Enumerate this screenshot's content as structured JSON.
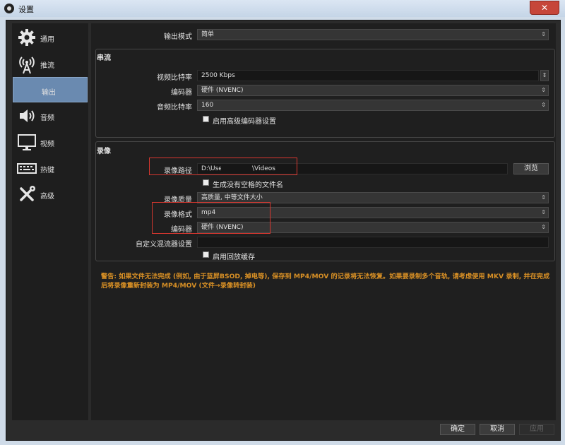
{
  "window": {
    "title": "设置",
    "close": "✕"
  },
  "sidebar": {
    "items": [
      {
        "label": "通用",
        "icon": "gear-icon"
      },
      {
        "label": "推流",
        "icon": "antenna-icon"
      },
      {
        "label": "输出",
        "icon": "output-icon",
        "active": true
      },
      {
        "label": "音频",
        "icon": "speaker-icon"
      },
      {
        "label": "视频",
        "icon": "monitor-icon"
      },
      {
        "label": "热键",
        "icon": "keyboard-icon"
      },
      {
        "label": "高级",
        "icon": "tools-icon"
      }
    ]
  },
  "output_mode": {
    "label": "输出模式",
    "value": "简单"
  },
  "streaming": {
    "title": "串流",
    "video_bitrate": {
      "label": "视频比特率",
      "value": "2500 Kbps"
    },
    "encoder": {
      "label": "编码器",
      "value": "硬件 (NVENC)"
    },
    "audio_bitrate": {
      "label": "音频比特率",
      "value": "160"
    },
    "advanced": {
      "label": "启用高级编码器设置",
      "checked": false
    }
  },
  "recording": {
    "title": "录像",
    "path": {
      "label": "录像路径",
      "value_start": "D:\\User",
      "value_end": "\\Videos"
    },
    "browse": "浏览",
    "no_space": {
      "label": "生成没有空格的文件名",
      "checked": false
    },
    "quality": {
      "label": "录像质量",
      "value": "高质量, 中等文件大小"
    },
    "format": {
      "label": "录像格式",
      "value": "mp4"
    },
    "encoder": {
      "label": "编码器",
      "value": "硬件 (NVENC)"
    },
    "muxer": {
      "label": "自定义混流器设置",
      "value": ""
    },
    "replay": {
      "label": "启用回放缓存",
      "checked": false
    }
  },
  "warning": "警告: 如果文件无法完成 (例如, 由于蓝屏BSOD, 掉电等), 保存到 MP4/MOV 的记录将无法恢复。如果要录制多个音轨, 请考虑使用 MKV 录制, 并在完成后将录像重新封装为 MP4/MOV (文件→录像转封装)",
  "buttons": {
    "ok": "确定",
    "cancel": "取消",
    "apply": "应用"
  },
  "colors": {
    "highlight": "#d9372f",
    "warning": "#d78f25",
    "active_nav": "#6a8ab0"
  }
}
